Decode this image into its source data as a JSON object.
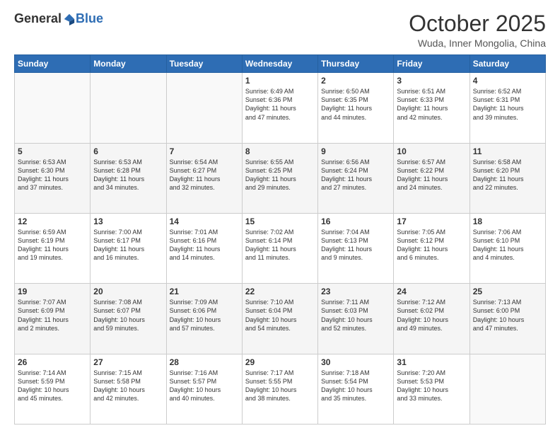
{
  "header": {
    "logo_general": "General",
    "logo_blue": "Blue",
    "title": "October 2025",
    "location": "Wuda, Inner Mongolia, China"
  },
  "days_of_week": [
    "Sunday",
    "Monday",
    "Tuesday",
    "Wednesday",
    "Thursday",
    "Friday",
    "Saturday"
  ],
  "weeks": [
    [
      {
        "day": "",
        "info": ""
      },
      {
        "day": "",
        "info": ""
      },
      {
        "day": "",
        "info": ""
      },
      {
        "day": "1",
        "info": "Sunrise: 6:49 AM\nSunset: 6:36 PM\nDaylight: 11 hours\nand 47 minutes."
      },
      {
        "day": "2",
        "info": "Sunrise: 6:50 AM\nSunset: 6:35 PM\nDaylight: 11 hours\nand 44 minutes."
      },
      {
        "day": "3",
        "info": "Sunrise: 6:51 AM\nSunset: 6:33 PM\nDaylight: 11 hours\nand 42 minutes."
      },
      {
        "day": "4",
        "info": "Sunrise: 6:52 AM\nSunset: 6:31 PM\nDaylight: 11 hours\nand 39 minutes."
      }
    ],
    [
      {
        "day": "5",
        "info": "Sunrise: 6:53 AM\nSunset: 6:30 PM\nDaylight: 11 hours\nand 37 minutes."
      },
      {
        "day": "6",
        "info": "Sunrise: 6:53 AM\nSunset: 6:28 PM\nDaylight: 11 hours\nand 34 minutes."
      },
      {
        "day": "7",
        "info": "Sunrise: 6:54 AM\nSunset: 6:27 PM\nDaylight: 11 hours\nand 32 minutes."
      },
      {
        "day": "8",
        "info": "Sunrise: 6:55 AM\nSunset: 6:25 PM\nDaylight: 11 hours\nand 29 minutes."
      },
      {
        "day": "9",
        "info": "Sunrise: 6:56 AM\nSunset: 6:24 PM\nDaylight: 11 hours\nand 27 minutes."
      },
      {
        "day": "10",
        "info": "Sunrise: 6:57 AM\nSunset: 6:22 PM\nDaylight: 11 hours\nand 24 minutes."
      },
      {
        "day": "11",
        "info": "Sunrise: 6:58 AM\nSunset: 6:20 PM\nDaylight: 11 hours\nand 22 minutes."
      }
    ],
    [
      {
        "day": "12",
        "info": "Sunrise: 6:59 AM\nSunset: 6:19 PM\nDaylight: 11 hours\nand 19 minutes."
      },
      {
        "day": "13",
        "info": "Sunrise: 7:00 AM\nSunset: 6:17 PM\nDaylight: 11 hours\nand 16 minutes."
      },
      {
        "day": "14",
        "info": "Sunrise: 7:01 AM\nSunset: 6:16 PM\nDaylight: 11 hours\nand 14 minutes."
      },
      {
        "day": "15",
        "info": "Sunrise: 7:02 AM\nSunset: 6:14 PM\nDaylight: 11 hours\nand 11 minutes."
      },
      {
        "day": "16",
        "info": "Sunrise: 7:04 AM\nSunset: 6:13 PM\nDaylight: 11 hours\nand 9 minutes."
      },
      {
        "day": "17",
        "info": "Sunrise: 7:05 AM\nSunset: 6:12 PM\nDaylight: 11 hours\nand 6 minutes."
      },
      {
        "day": "18",
        "info": "Sunrise: 7:06 AM\nSunset: 6:10 PM\nDaylight: 11 hours\nand 4 minutes."
      }
    ],
    [
      {
        "day": "19",
        "info": "Sunrise: 7:07 AM\nSunset: 6:09 PM\nDaylight: 11 hours\nand 2 minutes."
      },
      {
        "day": "20",
        "info": "Sunrise: 7:08 AM\nSunset: 6:07 PM\nDaylight: 10 hours\nand 59 minutes."
      },
      {
        "day": "21",
        "info": "Sunrise: 7:09 AM\nSunset: 6:06 PM\nDaylight: 10 hours\nand 57 minutes."
      },
      {
        "day": "22",
        "info": "Sunrise: 7:10 AM\nSunset: 6:04 PM\nDaylight: 10 hours\nand 54 minutes."
      },
      {
        "day": "23",
        "info": "Sunrise: 7:11 AM\nSunset: 6:03 PM\nDaylight: 10 hours\nand 52 minutes."
      },
      {
        "day": "24",
        "info": "Sunrise: 7:12 AM\nSunset: 6:02 PM\nDaylight: 10 hours\nand 49 minutes."
      },
      {
        "day": "25",
        "info": "Sunrise: 7:13 AM\nSunset: 6:00 PM\nDaylight: 10 hours\nand 47 minutes."
      }
    ],
    [
      {
        "day": "26",
        "info": "Sunrise: 7:14 AM\nSunset: 5:59 PM\nDaylight: 10 hours\nand 45 minutes."
      },
      {
        "day": "27",
        "info": "Sunrise: 7:15 AM\nSunset: 5:58 PM\nDaylight: 10 hours\nand 42 minutes."
      },
      {
        "day": "28",
        "info": "Sunrise: 7:16 AM\nSunset: 5:57 PM\nDaylight: 10 hours\nand 40 minutes."
      },
      {
        "day": "29",
        "info": "Sunrise: 7:17 AM\nSunset: 5:55 PM\nDaylight: 10 hours\nand 38 minutes."
      },
      {
        "day": "30",
        "info": "Sunrise: 7:18 AM\nSunset: 5:54 PM\nDaylight: 10 hours\nand 35 minutes."
      },
      {
        "day": "31",
        "info": "Sunrise: 7:20 AM\nSunset: 5:53 PM\nDaylight: 10 hours\nand 33 minutes."
      },
      {
        "day": "",
        "info": ""
      }
    ]
  ]
}
